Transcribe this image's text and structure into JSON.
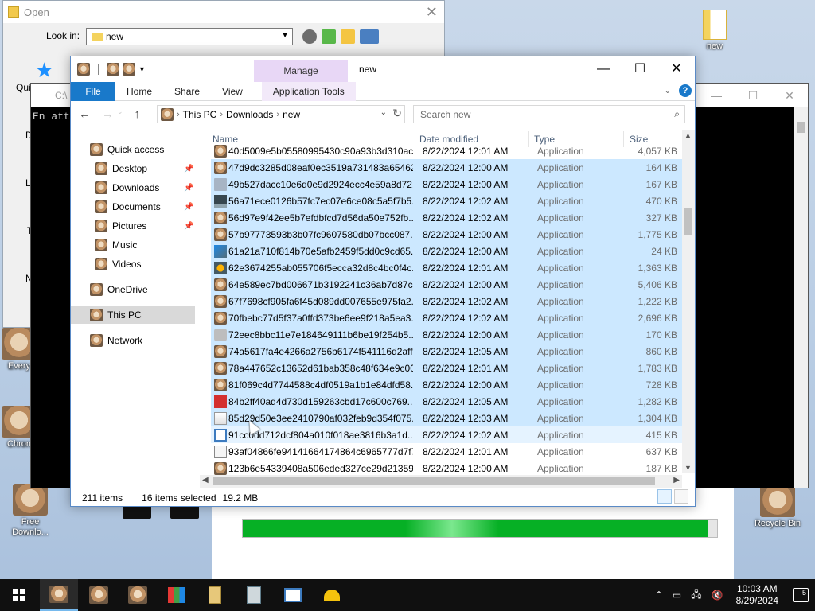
{
  "desktop": {
    "icons": [
      {
        "label": "new",
        "kind": "folder"
      },
      {
        "label": "Every",
        "kind": "app"
      },
      {
        "label": "Chron",
        "kind": "app"
      },
      {
        "label": "Free Downlo...",
        "kind": "app"
      },
      {
        "label": "Recycle Bin",
        "kind": "bin"
      }
    ]
  },
  "open_dialog": {
    "title": "Open",
    "lookin_label": "Look in:",
    "lookin_value": "new",
    "sidebar_fragments": [
      "Qui",
      "D",
      "L",
      "T",
      "N"
    ]
  },
  "console": {
    "title_fragment": "C:\\",
    "text": "En att"
  },
  "progress": {
    "fraction": 0.98
  },
  "explorer": {
    "title": "new",
    "manage_label": "Manage",
    "tabs": [
      "Home",
      "Share",
      "View"
    ],
    "file_label": "File",
    "app_tools_label": "Application Tools",
    "breadcrumbs": [
      "This PC",
      "Downloads",
      "new"
    ],
    "search_placeholder": "Search new",
    "nav": [
      {
        "label": "Quick access",
        "pinned": false,
        "indent": 0
      },
      {
        "label": "Desktop",
        "pinned": true,
        "indent": 1
      },
      {
        "label": "Downloads",
        "pinned": true,
        "indent": 1
      },
      {
        "label": "Documents",
        "pinned": true,
        "indent": 1
      },
      {
        "label": "Pictures",
        "pinned": true,
        "indent": 1
      },
      {
        "label": "Music",
        "pinned": false,
        "indent": 1
      },
      {
        "label": "Videos",
        "pinned": false,
        "indent": 1
      },
      {
        "label": "OneDrive",
        "pinned": false,
        "indent": 0
      },
      {
        "label": "This PC",
        "pinned": false,
        "indent": 0
      },
      {
        "label": "Network",
        "pinned": false,
        "indent": 0
      }
    ],
    "columns": {
      "name": "Name",
      "date": "Date modified",
      "type": "Type",
      "size": "Size"
    },
    "partial_row": {
      "name": "40d5009e5b05580995430c90a93b3d310ac...",
      "date": "8/22/2024 12:01 AM",
      "type": "Application",
      "size": "4,057 KB"
    },
    "files": [
      {
        "name": "47d9dc3285d08eaf0ec3519a731483a65462...",
        "date": "8/22/2024 12:00 AM",
        "type": "Application",
        "size": "164 KB",
        "selected": true,
        "icon": "cat"
      },
      {
        "name": "49b527dacc10e6d0e9d2924ecc4e59a8d72...",
        "date": "8/22/2024 12:00 AM",
        "type": "Application",
        "size": "167 KB",
        "selected": true,
        "icon": "blank"
      },
      {
        "name": "56a71ece0126b57fc7ec07e6ce08c5a5f7b5...",
        "date": "8/22/2024 12:02 AM",
        "type": "Application",
        "size": "470 KB",
        "selected": true,
        "icon": "monitor"
      },
      {
        "name": "56d97e9f42ee5b7efdbfcd7d56da50e752fb...",
        "date": "8/22/2024 12:02 AM",
        "type": "Application",
        "size": "327 KB",
        "selected": true,
        "icon": "cat"
      },
      {
        "name": "57b97773593b3b07fc9607580db07bcc087...",
        "date": "8/22/2024 12:00 AM",
        "type": "Application",
        "size": "1,775 KB",
        "selected": true,
        "icon": "cat"
      },
      {
        "name": "61a21a710f814b70e5afb2459f5dd0c9cd65...",
        "date": "8/22/2024 12:00 AM",
        "type": "Application",
        "size": "24 KB",
        "selected": true,
        "icon": "network"
      },
      {
        "name": "62e3674255ab055706f5ecca32d8c4bc0f4c...",
        "date": "8/22/2024 12:01 AM",
        "type": "Application",
        "size": "1,363 KB",
        "selected": true,
        "icon": "lock"
      },
      {
        "name": "64e589ec7bd006671b3192241c36ab7d87c...",
        "date": "8/22/2024 12:00 AM",
        "type": "Application",
        "size": "5,406 KB",
        "selected": true,
        "icon": "cat"
      },
      {
        "name": "67f7698cf905fa6f45d089dd007655e975fa2...",
        "date": "8/22/2024 12:02 AM",
        "type": "Application",
        "size": "1,222 KB",
        "selected": true,
        "icon": "cat"
      },
      {
        "name": "70fbebc77d5f37a0ffd373be6ee9f218a5ea3...",
        "date": "8/22/2024 12:02 AM",
        "type": "Application",
        "size": "2,696 KB",
        "selected": true,
        "icon": "cat"
      },
      {
        "name": "72eec8bbc11e7e184649111b6be19f254b5...",
        "date": "8/22/2024 12:00 AM",
        "type": "Application",
        "size": "170 KB",
        "selected": true,
        "icon": "grey"
      },
      {
        "name": "74a5617fa4e4266a2756b6174f541116d2aff...",
        "date": "8/22/2024 12:05 AM",
        "type": "Application",
        "size": "860 KB",
        "selected": true,
        "icon": "cat"
      },
      {
        "name": "78a447652c13652d61bab358c48f634e9c00...",
        "date": "8/22/2024 12:01 AM",
        "type": "Application",
        "size": "1,783 KB",
        "selected": true,
        "icon": "cat"
      },
      {
        "name": "81f069c4d7744588c4df0519a1b1e84dfd58...",
        "date": "8/22/2024 12:00 AM",
        "type": "Application",
        "size": "728 KB",
        "selected": true,
        "icon": "cat"
      },
      {
        "name": "84b2ff40ad4d730d159263cbd17c600c769...",
        "date": "8/22/2024 12:05 AM",
        "type": "Application",
        "size": "1,282 KB",
        "selected": true,
        "icon": "red"
      },
      {
        "name": "85d29d50e3ee2410790af032feb9d354f075...",
        "date": "8/22/2024 12:03 AM",
        "type": "Application",
        "size": "1,304 KB",
        "selected": true,
        "icon": "doc"
      },
      {
        "name": "91cc0dd712dcf804a010f018ae3816b3a1d...",
        "date": "8/22/2024 12:02 AM",
        "type": "Application",
        "size": "415 KB",
        "selected": false,
        "focus": true,
        "icon": "window"
      },
      {
        "name": "93af04866fe94141664174864c6965777d7f7...",
        "date": "8/22/2024 12:01 AM",
        "type": "Application",
        "size": "637 KB",
        "selected": false,
        "icon": "doc2"
      },
      {
        "name": "123b6e54339408a506eded327ce29d21359...",
        "date": "8/22/2024 12:00 AM",
        "type": "Application",
        "size": "187 KB",
        "selected": false,
        "icon": "cat"
      }
    ],
    "status": {
      "items": "211 items",
      "selected": "16 items selected",
      "size": "19.2 MB"
    }
  },
  "taskbar": {
    "time": "10:03 AM",
    "date": "8/29/2024",
    "notification_count": "5"
  },
  "colors": {
    "accent": "#1979ca",
    "selection": "#cce8ff",
    "progress": "#06b025"
  }
}
